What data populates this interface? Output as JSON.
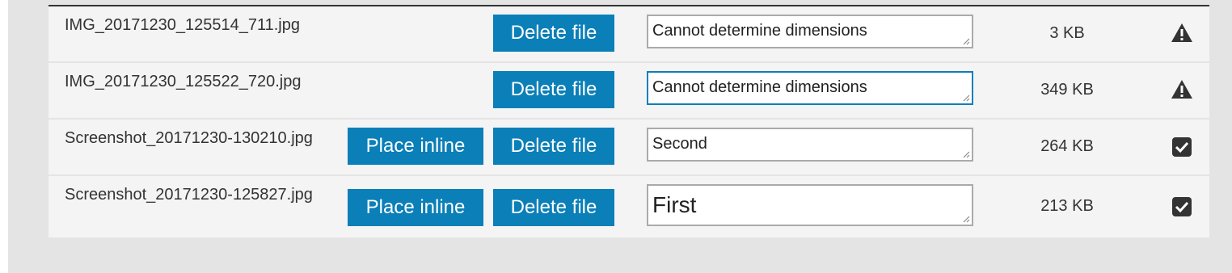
{
  "files": [
    {
      "filename": "IMG_20171230_125514_711.jpg",
      "place_inline_label": "",
      "delete_label": "Delete file",
      "caption": "Cannot determine dimensions",
      "size": "3 KB",
      "status_icon": "warning-icon"
    },
    {
      "filename": "IMG_20171230_125522_720.jpg",
      "place_inline_label": "",
      "delete_label": "Delete file",
      "caption": "Cannot determine dimensions",
      "size": "349 KB",
      "status_icon": "warning-icon"
    },
    {
      "filename": "Screenshot_20171230-130210.jpg",
      "place_inline_label": "Place inline",
      "delete_label": "Delete file",
      "caption": "Second",
      "size": "264 KB",
      "status_icon": "checked-checkbox-icon"
    },
    {
      "filename": "Screenshot_20171230-125827.jpg",
      "place_inline_label": "Place inline",
      "delete_label": "Delete file",
      "caption": "First",
      "size": "213 KB",
      "status_icon": "checked-checkbox-icon"
    }
  ],
  "colors": {
    "button_bg": "#0a7fb8",
    "button_text": "#ffffff",
    "row_bg": "#f4f4f4",
    "panel_bg": "#e4e4e4",
    "focus_border": "#0a7fb8"
  }
}
